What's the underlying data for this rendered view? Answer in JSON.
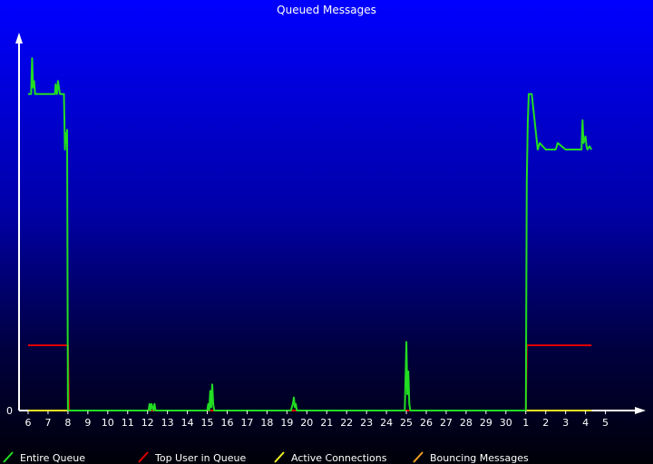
{
  "chart_data": {
    "type": "line",
    "title": "Queued Messages",
    "xlabel": "",
    "ylabel": "",
    "y_tick_labels": [
      "0"
    ],
    "ylim": [
      0,
      100
    ],
    "x_tick_labels": [
      "6",
      "7",
      "8",
      "9",
      "10",
      "11",
      "12",
      "13",
      "14",
      "15",
      "16",
      "17",
      "18",
      "19",
      "20",
      "21",
      "22",
      "23",
      "24",
      "25",
      "26",
      "27",
      "28",
      "29",
      "30",
      "1",
      "2",
      "3",
      "4",
      "5"
    ],
    "grid": false,
    "legend_placement": "bottom",
    "colors": {
      "entire_queue": "#22dd22",
      "top_user": "#dd0000",
      "active_connections": "#eeee22",
      "bouncing": "#f0a020",
      "axes": "#ffffff"
    },
    "series": [
      {
        "name": "Entire Queue",
        "x": [
          0,
          0.15,
          0.2,
          0.25,
          0.3,
          0.35,
          1.35,
          1.38,
          1.45,
          1.5,
          1.6,
          1.7,
          1.8,
          1.85,
          1.88,
          1.92,
          1.96,
          2.0,
          6.0,
          6.05,
          6.1,
          6.15,
          6.2,
          6.25,
          6.3,
          6.35,
          6.4,
          9.0,
          9.05,
          9.1,
          9.15,
          9.2,
          9.25,
          9.3,
          9.35,
          9.4,
          13.2,
          13.25,
          13.3,
          13.35,
          13.4,
          13.45,
          13.5,
          13.55,
          13.6,
          18.92,
          19.0,
          19.05,
          19.1,
          19.15,
          19.2,
          25.0,
          25.05,
          25.1,
          25.15,
          25.18,
          25.3,
          25.6,
          25.7,
          26.0,
          26.5,
          26.6,
          27.0,
          27.8,
          27.85,
          27.9,
          28.0,
          28.05,
          28.1,
          28.2,
          28.3
        ],
        "y": [
          97,
          97,
          108,
          99,
          101,
          97,
          97,
          100,
          97,
          101,
          97,
          97,
          97,
          80,
          85,
          82,
          86,
          0,
          0,
          0,
          2,
          0,
          2,
          1,
          0,
          2,
          0,
          0,
          2,
          0,
          6,
          1,
          8,
          2,
          0,
          0,
          0,
          1,
          2,
          4,
          1,
          2,
          0,
          0,
          0,
          0,
          21,
          5,
          12,
          2,
          0,
          0,
          70,
          88,
          97,
          97,
          97,
          80,
          82,
          80,
          80,
          82,
          80,
          80,
          89,
          82,
          84,
          81,
          80,
          81,
          80
        ],
        "values_note": ""
      },
      {
        "name": "Top User in Queue",
        "x": [
          0,
          2.0,
          2.05,
          25.0,
          25.05,
          28.3
        ],
        "y": [
          20,
          20,
          0,
          0,
          20,
          20
        ]
      },
      {
        "name": "Active Connections",
        "x": [
          0,
          28.3
        ],
        "y": [
          0,
          0
        ]
      },
      {
        "name": "Bouncing Messages",
        "x": [
          0,
          28.3
        ],
        "y": [
          0,
          0
        ]
      }
    ]
  }
}
